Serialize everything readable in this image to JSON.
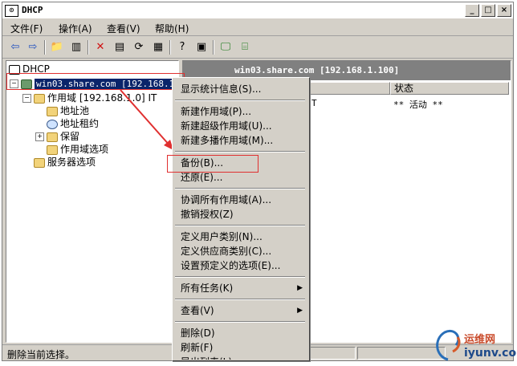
{
  "window": {
    "title": "DHCP",
    "icon_label": "DHCP"
  },
  "menubar": {
    "items": [
      "文件(F)",
      "操作(A)",
      "查看(V)",
      "帮助(H)"
    ]
  },
  "toolbar": {
    "icons": [
      "back-icon",
      "forward-icon",
      "up-folder-icon",
      "show-hide-tree-icon",
      "delete-icon",
      "properties-icon",
      "refresh-icon",
      "export-list-icon",
      "help-icon",
      "console-icon",
      "monitor-icon",
      "network-icon"
    ]
  },
  "tree": {
    "root": "DHCP",
    "server": "win03.share.com [192.168.1.10",
    "scope": "作用域 [192.168.1.0] IT",
    "pool": "地址池",
    "leases": "地址租约",
    "reservations": "保留",
    "scope_options": "作用域选项",
    "server_options": "服务器选项"
  },
  "right_pane": {
    "header_title": "win03.share.com [192.168.1.100]",
    "columns": [
      "",
      "状态"
    ],
    "row": {
      "name_fragment": "T",
      "status": "** 活动 **"
    }
  },
  "context_menu": {
    "group1": [
      "显示统计信息(S)..."
    ],
    "group2": [
      "新建作用域(P)...",
      "新建超级作用域(U)...",
      "新建多播作用域(M)..."
    ],
    "group3": [
      "备份(B)...",
      "还原(E)..."
    ],
    "group4": [
      "协调所有作用域(A)...",
      "撤销授权(Z)"
    ],
    "group5": [
      "定义用户类别(N)...",
      "定义供应商类别(C)...",
      "设置预定义的选项(E)..."
    ],
    "group6": [
      "所有任务(K)"
    ],
    "group7": [
      "查看(V)"
    ],
    "group8": [
      "删除(D)",
      "刷新(F)",
      "导出列表(L)..."
    ]
  },
  "statusbar": {
    "text": "删除当前选择。"
  },
  "watermark": {
    "line1": "运维网",
    "line2": "iyunv.com"
  },
  "colors": {
    "selection": "#0a246a",
    "highlight_box": "#e03030",
    "window_bg": "#d4d0c8"
  }
}
